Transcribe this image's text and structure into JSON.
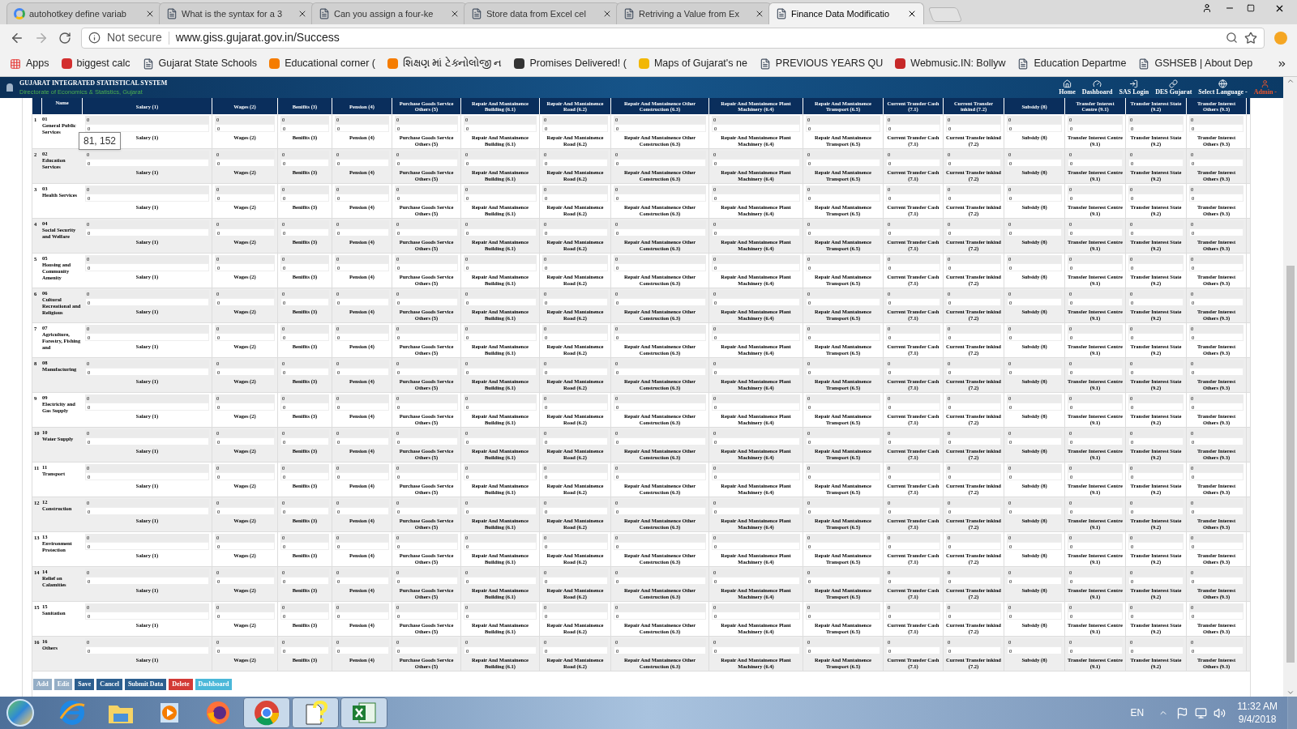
{
  "browser": {
    "tabs": [
      {
        "kind": "google",
        "title": "autohotkey define variab",
        "selected": false
      },
      {
        "kind": "page",
        "title": "What is the syntax for a 3",
        "selected": false
      },
      {
        "kind": "page",
        "title": "Can you assign a four-ke",
        "selected": false
      },
      {
        "kind": "page",
        "title": "Store data from Excel cel",
        "selected": false
      },
      {
        "kind": "page",
        "title": "Retriving a Value from Ex",
        "selected": false
      },
      {
        "kind": "page",
        "title": "Finance Data Modificatio",
        "selected": true
      }
    ],
    "security": "Not secure",
    "address": "www.giss.gujarat.gov.in/Success",
    "bookmarks": [
      {
        "kind": "apps",
        "label": "Apps"
      },
      {
        "kind": "site",
        "color": "#d32f2f",
        "label": "biggest calc"
      },
      {
        "kind": "page",
        "label": "Gujarat State Schools"
      },
      {
        "kind": "site",
        "color": "#f57c00",
        "label": "Educational corner ("
      },
      {
        "kind": "site",
        "color": "#f57c00",
        "label": "શિક્ષણ માં ટેક્નોલોજી ન"
      },
      {
        "kind": "site",
        "color": "#333333",
        "label": "Promises Delivered! ("
      },
      {
        "kind": "site",
        "color": "#f2b705",
        "label": "Maps of Gujarat's ne"
      },
      {
        "kind": "page",
        "label": "PREVIOUS YEARS QU"
      },
      {
        "kind": "site",
        "color": "#c62828",
        "label": "Webmusic.IN: Bollyw"
      },
      {
        "kind": "page",
        "label": "Education Departme"
      },
      {
        "kind": "page",
        "label": "GSHSEB | About Dep"
      }
    ]
  },
  "app": {
    "brand": "GUJARAT INTEGRATED STATISTICAL SYSTEM",
    "subtitle": "Directorate of Economics & Statistics, Gujarat",
    "nav": [
      {
        "kind": "home",
        "label": "Home",
        "color": "#ffffff"
      },
      {
        "kind": "dashboard",
        "label": "Dashboard",
        "color": "#ffffff"
      },
      {
        "kind": "login",
        "label": "SAS Login",
        "color": "#ffffff"
      },
      {
        "kind": "link",
        "label": "DES Gujarat",
        "color": "#ffffff"
      },
      {
        "kind": "language",
        "label": "Select Language -",
        "color": "#ffffff"
      },
      {
        "kind": "user",
        "label": "Admin -",
        "color": "#f0562b"
      }
    ]
  },
  "table": {
    "name_column": "Name",
    "columns": [
      "Salary (1)",
      "Wages (2)",
      "Benifits (3)",
      "Pension (4)",
      "Purchase Goods Service Others (5)",
      "Repair And Mantainence Building (6.1)",
      "Repair And Mantainence Road (6.2)",
      "Repair And Mantainence Other Construction (6.3)",
      "Repair And Mantainence Plant Machinery (6.4)",
      "Repair And Mantainence Transport (6.5)",
      "Current Transfer Cash (7.1)",
      "Current Transfer inkind (7.2)",
      "Subsidy (8)",
      "Transfer Interest Centre (9.1)",
      "Transfer Interest State (9.2)",
      "Transfer Interest Others (9.3)"
    ],
    "rows": [
      {
        "index": "1",
        "code": "01",
        "name": "General Public Services",
        "cells": [
          [
            "0",
            "0",
            "Salary (1)"
          ],
          [
            "0",
            "0",
            "Wages (2)"
          ],
          [
            "0",
            "0",
            "Benifits (3)"
          ],
          [
            "0",
            "0",
            "Pension (4)"
          ],
          [
            "0",
            "0",
            "Purchase Goods Service Others (5)"
          ],
          [
            "0",
            "0",
            "Repair And Mantainence Building (6.1)"
          ],
          [
            "0",
            "0",
            "Repair And Mantainence Road (6.2)"
          ],
          [
            "0",
            "0",
            "Repair And Mantainence Other Construction (6.3)"
          ],
          [
            "0",
            "0",
            "Repair And Mantainence Plant Machinery (6.4)"
          ],
          [
            "0",
            "0",
            "Repair And Mantainence Transport (6.5)"
          ],
          [
            "0",
            "0",
            "Current Transfer Cash (7.1)"
          ],
          [
            "0",
            "0",
            "Current Transfer inkind (7.2)"
          ],
          [
            "0",
            "0",
            "Subsidy (8)"
          ],
          [
            "0",
            "0",
            "Transfer Interest Centre (9.1)"
          ],
          [
            "0",
            "0",
            "Transfer Interest State (9.2)"
          ],
          [
            "0",
            "0",
            "Transfer Interest Others (9.3)"
          ]
        ]
      },
      {
        "index": "2",
        "code": "02",
        "name": "Education Services",
        "cells": [
          [
            "0",
            "0",
            "Salary (1)"
          ],
          [
            "0",
            "0",
            "Wages (2)"
          ],
          [
            "0",
            "0",
            "Benifits (3)"
          ],
          [
            "0",
            "0",
            "Pension (4)"
          ],
          [
            "0",
            "0",
            "Purchase Goods Service Others (5)"
          ],
          [
            "0",
            "0",
            "Repair And Mantainence Building (6.1)"
          ],
          [
            "0",
            "0",
            "Repair And Mantainence Road (6.2)"
          ],
          [
            "0",
            "0",
            "Repair And Mantainence Other Construction (6.3)"
          ],
          [
            "0",
            "0",
            "Repair And Mantainence Plant Machinery (6.4)"
          ],
          [
            "0",
            "0",
            "Repair And Mantainence Transport (6.5)"
          ],
          [
            "0",
            "0",
            "Current Transfer Cash (7.1)"
          ],
          [
            "0",
            "0",
            "Current Transfer inkind (7.2)"
          ],
          [
            "0",
            "0",
            "Subsidy (8)"
          ],
          [
            "0",
            "0",
            "Transfer Interest Centre (9.1)"
          ],
          [
            "0",
            "0",
            "Transfer Interest State (9.2)"
          ],
          [
            "0",
            "0",
            "Transfer Interest Others (9.3)"
          ]
        ]
      },
      {
        "index": "3",
        "code": "03",
        "name": "Health Services",
        "cells": [
          [
            "0",
            "0",
            "Salary (1)"
          ],
          [
            "0",
            "0",
            "Wages (2)"
          ],
          [
            "0",
            "0",
            "Benifits (3)"
          ],
          [
            "0",
            "0",
            "Pension (4)"
          ],
          [
            "0",
            "0",
            "Purchase Goods Service Others (5)"
          ],
          [
            "0",
            "0",
            "Repair And Mantainence Building (6.1)"
          ],
          [
            "0",
            "0",
            "Repair And Mantainence Road (6.2)"
          ],
          [
            "0",
            "0",
            "Repair And Mantainence Other Construction (6.3)"
          ],
          [
            "0",
            "0",
            "Repair And Mantainence Plant Machinery (6.4)"
          ],
          [
            "0",
            "0",
            "Repair And Mantainence Transport (6.5)"
          ],
          [
            "0",
            "0",
            "Current Transfer Cash (7.1)"
          ],
          [
            "0",
            "0",
            "Current Transfer inkind (7.2)"
          ],
          [
            "0",
            "0",
            "Subsidy (8)"
          ],
          [
            "0",
            "0",
            "Transfer Interest Centre (9.1)"
          ],
          [
            "0",
            "0",
            "Transfer Interest State (9.2)"
          ],
          [
            "0",
            "0",
            "Transfer Interest Others (9.3)"
          ]
        ]
      },
      {
        "index": "4",
        "code": "04",
        "name": "Social Security and Welfare",
        "cells": [
          [
            "0",
            "0",
            "Salary (1)"
          ],
          [
            "0",
            "0",
            "Wages (2)"
          ],
          [
            "0",
            "0",
            "Benifits (3)"
          ],
          [
            "0",
            "0",
            "Pension (4)"
          ],
          [
            "0",
            "0",
            "Purchase Goods Service Others (5)"
          ],
          [
            "0",
            "0",
            "Repair And Mantainence Building (6.1)"
          ],
          [
            "0",
            "0",
            "Repair And Mantainence Road (6.2)"
          ],
          [
            "0",
            "0",
            "Repair And Mantainence Other Construction (6.3)"
          ],
          [
            "0",
            "0",
            "Repair And Mantainence Plant Machinery (6.4)"
          ],
          [
            "0",
            "0",
            "Repair And Mantainence Transport (6.5)"
          ],
          [
            "0",
            "0",
            "Current Transfer Cash (7.1)"
          ],
          [
            "0",
            "0",
            "Current Transfer inkind (7.2)"
          ],
          [
            "0",
            "0",
            "Subsidy (8)"
          ],
          [
            "0",
            "0",
            "Transfer Interest Centre (9.1)"
          ],
          [
            "0",
            "0",
            "Transfer Interest State (9.2)"
          ],
          [
            "0",
            "0",
            "Transfer Interest Others (9.3)"
          ]
        ]
      },
      {
        "index": "5",
        "code": "05",
        "name": "Housing and Community Amenity",
        "cells": [
          [
            "0",
            "0",
            "Salary (1)"
          ],
          [
            "0",
            "0",
            "Wages (2)"
          ],
          [
            "0",
            "0",
            "Benifits (3)"
          ],
          [
            "0",
            "0",
            "Pension (4)"
          ],
          [
            "0",
            "0",
            "Purchase Goods Service Others (5)"
          ],
          [
            "0",
            "0",
            "Repair And Mantainence Building (6.1)"
          ],
          [
            "0",
            "0",
            "Repair And Mantainence Road (6.2)"
          ],
          [
            "0",
            "0",
            "Repair And Mantainence Other Construction (6.3)"
          ],
          [
            "0",
            "0",
            "Repair And Mantainence Plant Machinery (6.4)"
          ],
          [
            "0",
            "0",
            "Repair And Mantainence Transport (6.5)"
          ],
          [
            "0",
            "0",
            "Current Transfer Cash (7.1)"
          ],
          [
            "0",
            "0",
            "Current Transfer inkind (7.2)"
          ],
          [
            "0",
            "0",
            "Subsidy (8)"
          ],
          [
            "0",
            "0",
            "Transfer Interest Centre (9.1)"
          ],
          [
            "0",
            "0",
            "Transfer Interest State (9.2)"
          ],
          [
            "0",
            "0",
            "Transfer Interest Others (9.3)"
          ]
        ]
      },
      {
        "index": "6",
        "code": "06",
        "name": "Cultural Recreational and Religious",
        "cells": [
          [
            "0",
            "0",
            "Salary (1)"
          ],
          [
            "0",
            "0",
            "Wages (2)"
          ],
          [
            "0",
            "0",
            "Benifits (3)"
          ],
          [
            "0",
            "0",
            "Pension (4)"
          ],
          [
            "0",
            "0",
            "Purchase Goods Service Others (5)"
          ],
          [
            "0",
            "0",
            "Repair And Mantainence Building (6.1)"
          ],
          [
            "0",
            "0",
            "Repair And Mantainence Road (6.2)"
          ],
          [
            "0",
            "0",
            "Repair And Mantainence Other Construction (6.3)"
          ],
          [
            "0",
            "0",
            "Repair And Mantainence Plant Machinery (6.4)"
          ],
          [
            "0",
            "0",
            "Repair And Mantainence Transport (6.5)"
          ],
          [
            "0",
            "0",
            "Current Transfer Cash (7.1)"
          ],
          [
            "0",
            "0",
            "Current Transfer inkind (7.2)"
          ],
          [
            "0",
            "0",
            "Subsidy (8)"
          ],
          [
            "0",
            "0",
            "Transfer Interest Centre (9.1)"
          ],
          [
            "0",
            "0",
            "Transfer Interest State (9.2)"
          ],
          [
            "0",
            "0",
            "Transfer Interest Others (9.3)"
          ]
        ]
      },
      {
        "index": "7",
        "code": "07",
        "name": "Agriculture, Forestry, Fishing and",
        "cells": [
          [
            "0",
            "0",
            "Salary (1)"
          ],
          [
            "0",
            "0",
            "Wages (2)"
          ],
          [
            "0",
            "0",
            "Benifits (3)"
          ],
          [
            "0",
            "0",
            "Pension (4)"
          ],
          [
            "0",
            "0",
            "Purchase Goods Service Others (5)"
          ],
          [
            "0",
            "0",
            "Repair And Mantainence Building (6.1)"
          ],
          [
            "0",
            "0",
            "Repair And Mantainence Road (6.2)"
          ],
          [
            "0",
            "0",
            "Repair And Mantainence Other Construction (6.3)"
          ],
          [
            "0",
            "0",
            "Repair And Mantainence Plant Machinery (6.4)"
          ],
          [
            "0",
            "0",
            "Repair And Mantainence Transport (6.5)"
          ],
          [
            "0",
            "0",
            "Current Transfer Cash (7.1)"
          ],
          [
            "0",
            "0",
            "Current Transfer inkind (7.2)"
          ],
          [
            "0",
            "0",
            "Subsidy (8)"
          ],
          [
            "0",
            "0",
            "Transfer Interest Centre (9.1)"
          ],
          [
            "0",
            "0",
            "Transfer Interest State (9.2)"
          ],
          [
            "0",
            "0",
            "Transfer Interest Others (9.3)"
          ]
        ]
      },
      {
        "index": "8",
        "code": "08",
        "name": "Manufacturing",
        "cells": [
          [
            "0",
            "0",
            "Salary (1)"
          ],
          [
            "0",
            "0",
            "Wages (2)"
          ],
          [
            "0",
            "0",
            "Benifits (3)"
          ],
          [
            "0",
            "0",
            "Pension (4)"
          ],
          [
            "0",
            "0",
            "Purchase Goods Service Others (5)"
          ],
          [
            "0",
            "0",
            "Repair And Mantainence Building (6.1)"
          ],
          [
            "0",
            "0",
            "Repair And Mantainence Road (6.2)"
          ],
          [
            "0",
            "0",
            "Repair And Mantainence Other Construction (6.3)"
          ],
          [
            "0",
            "0",
            "Repair And Mantainence Plant Machinery (6.4)"
          ],
          [
            "0",
            "0",
            "Repair And Mantainence Transport (6.5)"
          ],
          [
            "0",
            "0",
            "Current Transfer Cash (7.1)"
          ],
          [
            "0",
            "0",
            "Current Transfer inkind (7.2)"
          ],
          [
            "0",
            "0",
            "Subsidy (8)"
          ],
          [
            "0",
            "0",
            "Transfer Interest Centre (9.1)"
          ],
          [
            "0",
            "0",
            "Transfer Interest State (9.2)"
          ],
          [
            "0",
            "0",
            "Transfer Interest Others (9.3)"
          ]
        ]
      },
      {
        "index": "9",
        "code": "09",
        "name": "Electricity and Gas Supply",
        "cells": [
          [
            "0",
            "0",
            "Salary (1)"
          ],
          [
            "0",
            "0",
            "Wages (2)"
          ],
          [
            "0",
            "0",
            "Benifits (3)"
          ],
          [
            "0",
            "0",
            "Pension (4)"
          ],
          [
            "0",
            "0",
            "Purchase Goods Service Others (5)"
          ],
          [
            "0",
            "0",
            "Repair And Mantainence Building (6.1)"
          ],
          [
            "0",
            "0",
            "Repair And Mantainence Road (6.2)"
          ],
          [
            "0",
            "0",
            "Repair And Mantainence Other Construction (6.3)"
          ],
          [
            "0",
            "0",
            "Repair And Mantainence Plant Machinery (6.4)"
          ],
          [
            "0",
            "0",
            "Repair And Mantainence Transport (6.5)"
          ],
          [
            "0",
            "0",
            "Current Transfer Cash (7.1)"
          ],
          [
            "0",
            "0",
            "Current Transfer inkind (7.2)"
          ],
          [
            "0",
            "0",
            "Subsidy (8)"
          ],
          [
            "0",
            "0",
            "Transfer Interest Centre (9.1)"
          ],
          [
            "0",
            "0",
            "Transfer Interest State (9.2)"
          ],
          [
            "0",
            "0",
            "Transfer Interest Others (9.3)"
          ]
        ]
      },
      {
        "index": "10",
        "code": "10",
        "name": "Water Supply",
        "cells": [
          [
            "0",
            "0",
            "Salary (1)"
          ],
          [
            "0",
            "0",
            "Wages (2)"
          ],
          [
            "0",
            "0",
            "Benifits (3)"
          ],
          [
            "0",
            "0",
            "Pension (4)"
          ],
          [
            "0",
            "0",
            "Purchase Goods Service Others (5)"
          ],
          [
            "0",
            "0",
            "Repair And Mantainence Building (6.1)"
          ],
          [
            "0",
            "0",
            "Repair And Mantainence Road (6.2)"
          ],
          [
            "0",
            "0",
            "Repair And Mantainence Other Construction (6.3)"
          ],
          [
            "0",
            "0",
            "Repair And Mantainence Plant Machinery (6.4)"
          ],
          [
            "0",
            "0",
            "Repair And Mantainence Transport (6.5)"
          ],
          [
            "0",
            "0",
            "Current Transfer Cash (7.1)"
          ],
          [
            "0",
            "0",
            "Current Transfer inkind (7.2)"
          ],
          [
            "0",
            "0",
            "Subsidy (8)"
          ],
          [
            "0",
            "0",
            "Transfer Interest Centre (9.1)"
          ],
          [
            "0",
            "0",
            "Transfer Interest State (9.2)"
          ],
          [
            "0",
            "0",
            "Transfer Interest Others (9.3)"
          ]
        ]
      },
      {
        "index": "11",
        "code": "11",
        "name": "Transport",
        "cells": [
          [
            "0",
            "0",
            "Salary (1)"
          ],
          [
            "0",
            "0",
            "Wages (2)"
          ],
          [
            "0",
            "0",
            "Benifits (3)"
          ],
          [
            "0",
            "0",
            "Pension (4)"
          ],
          [
            "0",
            "0",
            "Purchase Goods Service Others (5)"
          ],
          [
            "0",
            "0",
            "Repair And Mantainence Building (6.1)"
          ],
          [
            "0",
            "0",
            "Repair And Mantainence Road (6.2)"
          ],
          [
            "0",
            "0",
            "Repair And Mantainence Other Construction (6.3)"
          ],
          [
            "0",
            "0",
            "Repair And Mantainence Plant Machinery (6.4)"
          ],
          [
            "0",
            "0",
            "Repair And Mantainence Transport (6.5)"
          ],
          [
            "0",
            "0",
            "Current Transfer Cash (7.1)"
          ],
          [
            "0",
            "0",
            "Current Transfer inkind (7.2)"
          ],
          [
            "0",
            "0",
            "Subsidy (8)"
          ],
          [
            "0",
            "0",
            "Transfer Interest Centre (9.1)"
          ],
          [
            "0",
            "0",
            "Transfer Interest State (9.2)"
          ],
          [
            "0",
            "0",
            "Transfer Interest Others (9.3)"
          ]
        ]
      },
      {
        "index": "12",
        "code": "12",
        "name": "Construction",
        "cells": [
          [
            "0",
            "0",
            "Salary (1)"
          ],
          [
            "0",
            "0",
            "Wages (2)"
          ],
          [
            "0",
            "0",
            "Benifits (3)"
          ],
          [
            "0",
            "0",
            "Pension (4)"
          ],
          [
            "0",
            "0",
            "Purchase Goods Service Others (5)"
          ],
          [
            "0",
            "0",
            "Repair And Mantainence Building (6.1)"
          ],
          [
            "0",
            "0",
            "Repair And Mantainence Road (6.2)"
          ],
          [
            "0",
            "0",
            "Repair And Mantainence Other Construction (6.3)"
          ],
          [
            "0",
            "0",
            "Repair And Mantainence Plant Machinery (6.4)"
          ],
          [
            "0",
            "0",
            "Repair And Mantainence Transport (6.5)"
          ],
          [
            "0",
            "0",
            "Current Transfer Cash (7.1)"
          ],
          [
            "0",
            "0",
            "Current Transfer inkind (7.2)"
          ],
          [
            "0",
            "0",
            "Subsidy (8)"
          ],
          [
            "0",
            "0",
            "Transfer Interest Centre (9.1)"
          ],
          [
            "0",
            "0",
            "Transfer Interest State (9.2)"
          ],
          [
            "0",
            "0",
            "Transfer Interest Others (9.3)"
          ]
        ]
      },
      {
        "index": "13",
        "code": "13",
        "name": "Environment Protection",
        "cells": [
          [
            "0",
            "0",
            "Salary (1)"
          ],
          [
            "0",
            "0",
            "Wages (2)"
          ],
          [
            "0",
            "0",
            "Benifits (3)"
          ],
          [
            "0",
            "0",
            "Pension (4)"
          ],
          [
            "0",
            "0",
            "Purchase Goods Service Others (5)"
          ],
          [
            "0",
            "0",
            "Repair And Mantainence Building (6.1)"
          ],
          [
            "0",
            "0",
            "Repair And Mantainence Road (6.2)"
          ],
          [
            "0",
            "0",
            "Repair And Mantainence Other Construction (6.3)"
          ],
          [
            "0",
            "0",
            "Repair And Mantainence Plant Machinery (6.4)"
          ],
          [
            "0",
            "0",
            "Repair And Mantainence Transport (6.5)"
          ],
          [
            "0",
            "0",
            "Current Transfer Cash (7.1)"
          ],
          [
            "0",
            "0",
            "Current Transfer inkind (7.2)"
          ],
          [
            "0",
            "0",
            "Subsidy (8)"
          ],
          [
            "0",
            "0",
            "Transfer Interest Centre (9.1)"
          ],
          [
            "0",
            "0",
            "Transfer Interest State (9.2)"
          ],
          [
            "0",
            "0",
            "Transfer Interest Others (9.3)"
          ]
        ]
      },
      {
        "index": "14",
        "code": "14",
        "name": "Relief on Calamities",
        "cells": [
          [
            "0",
            "0",
            "Salary (1)"
          ],
          [
            "0",
            "0",
            "Wages (2)"
          ],
          [
            "0",
            "0",
            "Benifits (3)"
          ],
          [
            "0",
            "0",
            "Pension (4)"
          ],
          [
            "0",
            "0",
            "Purchase Goods Service Others (5)"
          ],
          [
            "0",
            "0",
            "Repair And Mantainence Building (6.1)"
          ],
          [
            "0",
            "0",
            "Repair And Mantainence Road (6.2)"
          ],
          [
            "0",
            "0",
            "Repair And Mantainence Other Construction (6.3)"
          ],
          [
            "0",
            "0",
            "Repair And Mantainence Plant Machinery (6.4)"
          ],
          [
            "0",
            "0",
            "Repair And Mantainence Transport (6.5)"
          ],
          [
            "0",
            "0",
            "Current Transfer Cash (7.1)"
          ],
          [
            "0",
            "0",
            "Current Transfer inkind (7.2)"
          ],
          [
            "0",
            "0",
            "Subsidy (8)"
          ],
          [
            "0",
            "0",
            "Transfer Interest Centre (9.1)"
          ],
          [
            "0",
            "0",
            "Transfer Interest State (9.2)"
          ],
          [
            "0",
            "0",
            "Transfer Interest Others (9.3)"
          ]
        ]
      },
      {
        "index": "15",
        "code": "15",
        "name": "Sanitation",
        "cells": [
          [
            "0",
            "0",
            "Salary (1)"
          ],
          [
            "0",
            "0",
            "Wages (2)"
          ],
          [
            "0",
            "0",
            "Benifits (3)"
          ],
          [
            "0",
            "0",
            "Pension (4)"
          ],
          [
            "0",
            "0",
            "Purchase Goods Service Others (5)"
          ],
          [
            "0",
            "0",
            "Repair And Mantainence Building (6.1)"
          ],
          [
            "0",
            "0",
            "Repair And Mantainence Road (6.2)"
          ],
          [
            "0",
            "0",
            "Repair And Mantainence Other Construction (6.3)"
          ],
          [
            "0",
            "0",
            "Repair And Mantainence Plant Machinery (6.4)"
          ],
          [
            "0",
            "0",
            "Repair And Mantainence Transport (6.5)"
          ],
          [
            "0",
            "0",
            "Current Transfer Cash (7.1)"
          ],
          [
            "0",
            "0",
            "Current Transfer inkind (7.2)"
          ],
          [
            "0",
            "0",
            "Subsidy (8)"
          ],
          [
            "0",
            "0",
            "Transfer Interest Centre (9.1)"
          ],
          [
            "0",
            "0",
            "Transfer Interest State (9.2)"
          ],
          [
            "0",
            "0",
            "Transfer Interest Others (9.3)"
          ]
        ]
      },
      {
        "index": "16",
        "code": "16",
        "name": "Others",
        "cells": [
          [
            "0",
            "0",
            "Salary (1)"
          ],
          [
            "0",
            "0",
            "Wages (2)"
          ],
          [
            "0",
            "0",
            "Benifits (3)"
          ],
          [
            "0",
            "0",
            "Pension (4)"
          ],
          [
            "0",
            "0",
            "Purchase Goods Service Others (5)"
          ],
          [
            "0",
            "0",
            "Repair And Mantainence Building (6.1)"
          ],
          [
            "0",
            "0",
            "Repair And Mantainence Road (6.2)"
          ],
          [
            "0",
            "0",
            "Repair And Mantainence Other Construction (6.3)"
          ],
          [
            "0",
            "0",
            "Repair And Mantainence Plant Machinery (6.4)"
          ],
          [
            "0",
            "0",
            "Repair And Mantainence Transport (6.5)"
          ],
          [
            "0",
            "0",
            "Current Transfer Cash (7.1)"
          ],
          [
            "0",
            "0",
            "Current Transfer inkind (7.2)"
          ],
          [
            "0",
            "0",
            "Subsidy (8)"
          ],
          [
            "0",
            "0",
            "Transfer Interest Centre (9.1)"
          ],
          [
            "0",
            "0",
            "Transfer Interest State (9.2)"
          ],
          [
            "0",
            "0",
            "Transfer Interest Others (9.3)"
          ]
        ]
      }
    ]
  },
  "tooltip": "81, 152",
  "actions": [
    {
      "kind": "primary",
      "label": "Add",
      "disabled": true
    },
    {
      "kind": "primary",
      "label": "Edit",
      "disabled": true
    },
    {
      "kind": "primary",
      "label": "Save",
      "disabled": false
    },
    {
      "kind": "primary",
      "label": "Cancel",
      "disabled": false
    },
    {
      "kind": "primary",
      "label": "Submit Data",
      "disabled": false
    },
    {
      "kind": "danger",
      "label": "Delete",
      "disabled": false
    },
    {
      "kind": "info",
      "label": "Dashboard",
      "disabled": false
    }
  ],
  "taskbar": {
    "apps": [
      {
        "kind": "ie",
        "selected": false
      },
      {
        "kind": "folder",
        "selected": false
      },
      {
        "kind": "media",
        "selected": false
      },
      {
        "kind": "firefox",
        "selected": false
      },
      {
        "kind": "chrome",
        "selected": true
      },
      {
        "kind": "help",
        "selected": true
      },
      {
        "kind": "excel",
        "selected": true
      }
    ],
    "language": "EN",
    "time": "11:32 AM",
    "date": "9/4/2018"
  }
}
